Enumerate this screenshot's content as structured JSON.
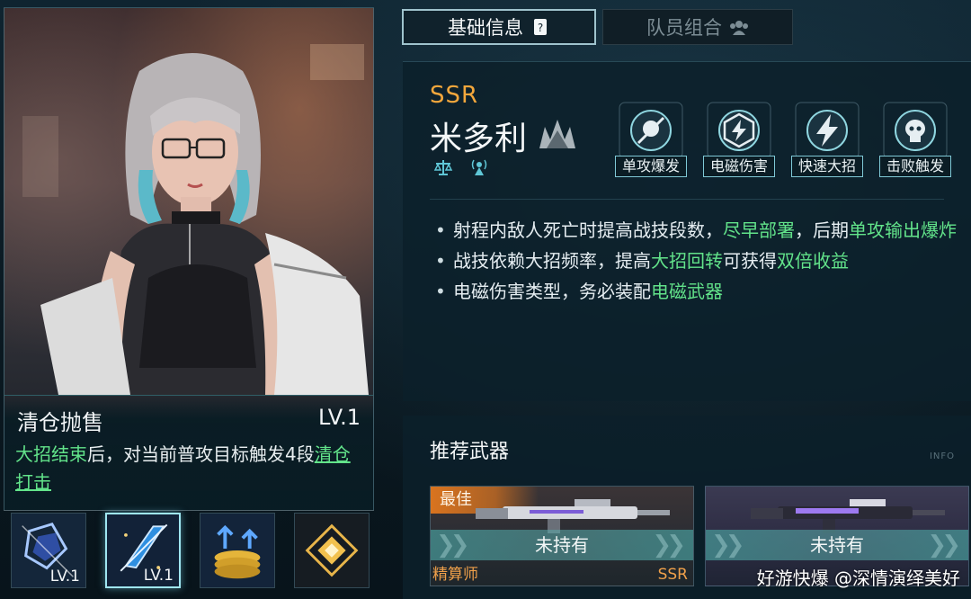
{
  "tabs": {
    "basic_info": "基础信息",
    "team_combo": "队员组合"
  },
  "skill": {
    "name": "清仓抛售",
    "level": "LV.1",
    "desc_part1": "大招结束",
    "desc_part2": "后，对当前普攻目标触发4段",
    "desc_part3": "清仓打击"
  },
  "skill_icons": [
    {
      "level": "LV.1"
    },
    {
      "level": "LV.1"
    },
    {
      "level": ""
    },
    {
      "level": ""
    }
  ],
  "character": {
    "rarity": "SSR",
    "name": "米多利"
  },
  "tags": [
    "单攻爆发",
    "电磁伤害",
    "快速大招",
    "击败触发"
  ],
  "description": {
    "line1_a": "射程内敌人死亡时提高战技段数，",
    "line1_b": "尽早部署",
    "line1_c": "，后期",
    "line1_d": "单攻输出爆炸",
    "line2_a": "战技依赖大招频率，提高",
    "line2_b": "大招回转",
    "line2_c": "可获得",
    "line2_d": "双倍收益",
    "line3_a": "电磁伤害类型，务必装配",
    "line3_b": "电磁武器"
  },
  "weapons": {
    "title": "推荐武器",
    "info_tag": "INFO",
    "best_label": "最佳",
    "cards": [
      {
        "status": "未持有",
        "name": "精算师",
        "rarity": "SSR"
      },
      {
        "status": "未持有",
        "name": "",
        "rarity": ""
      }
    ]
  },
  "watermark": "好游快爆 @深情演绎美好",
  "colors": {
    "highlight": "#62e38a",
    "rarity": "#f3a73c",
    "accent_border": "#9fe6f0"
  }
}
